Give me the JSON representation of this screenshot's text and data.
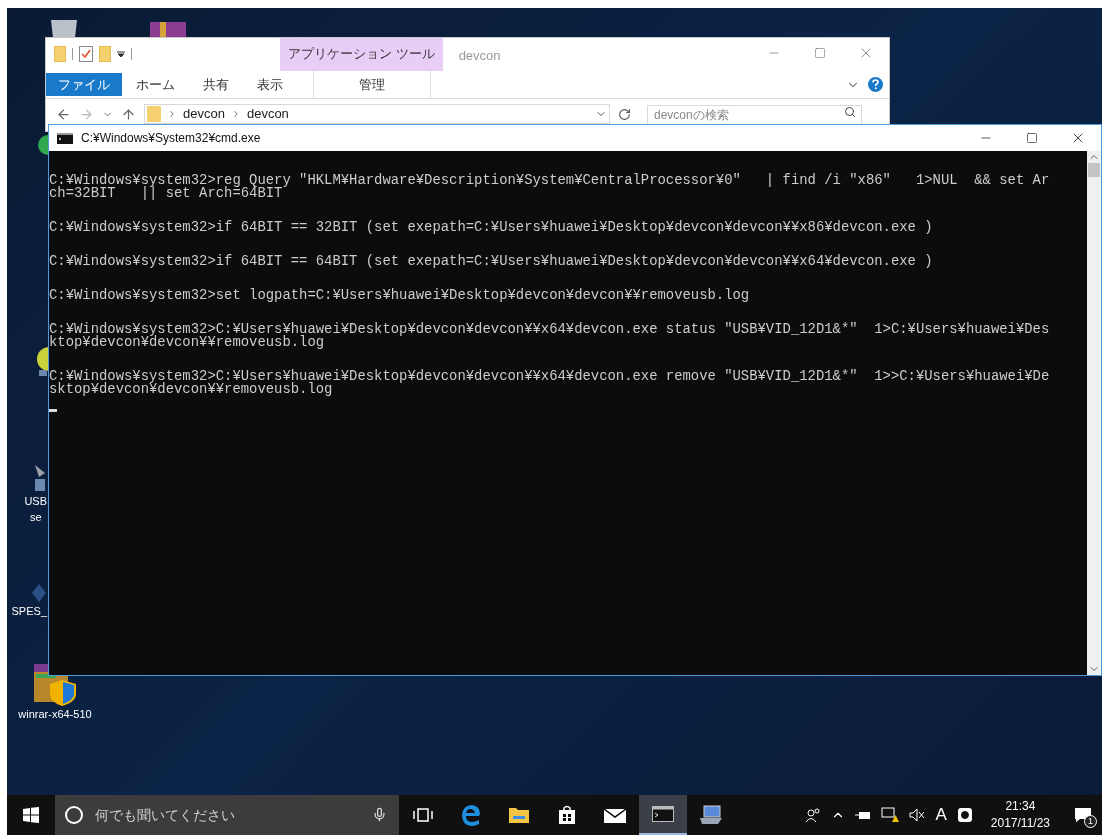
{
  "desktop": {
    "icons": [
      {
        "kind": "setup",
        "lines": [
          "USB",
          "se"
        ]
      },
      {
        "kind": "generic",
        "lines": [
          "SPES_"
        ]
      },
      {
        "kind": "winrar",
        "lines": [
          "winrar-x64-510"
        ]
      }
    ]
  },
  "explorer": {
    "context_group": "アプリケーション ツール",
    "title": "devcon",
    "tabs": [
      {
        "label": "ファイル",
        "kind": "file"
      },
      {
        "label": "ホーム",
        "kind": "tab"
      },
      {
        "label": "共有",
        "kind": "tab"
      },
      {
        "label": "表示",
        "kind": "tab"
      },
      {
        "label": "管理",
        "kind": "context"
      }
    ],
    "breadcrumb": [
      "devcon",
      "devcon"
    ],
    "search": {
      "placeholder": "devconの検索"
    }
  },
  "cmd": {
    "title": "C:¥Windows¥System32¥cmd.exe",
    "blocks": [
      {
        "lines": [
          "C:¥Windows¥system32>reg Query \"HKLM¥Hardware¥Description¥System¥CentralProcessor¥0\"   | find /i \"x86\"   1>NUL  && set Ar",
          "ch=32BIT   || set Arch=64BIT"
        ]
      },
      {
        "lines": [
          "C:¥Windows¥system32>if 64BIT == 32BIT (set exepath=C:¥Users¥huawei¥Desktop¥devcon¥devcon¥¥x86¥devcon.exe )"
        ]
      },
      {
        "lines": [
          "C:¥Windows¥system32>if 64BIT == 64BIT (set exepath=C:¥Users¥huawei¥Desktop¥devcon¥devcon¥¥x64¥devcon.exe )"
        ]
      },
      {
        "lines": [
          "C:¥Windows¥system32>set logpath=C:¥Users¥huawei¥Desktop¥devcon¥devcon¥¥removeusb.log"
        ]
      },
      {
        "lines": [
          "C:¥Windows¥system32>C:¥Users¥huawei¥Desktop¥devcon¥devcon¥¥x64¥devcon.exe status \"USB¥VID_12D1&*\"  1>C:¥Users¥huawei¥Des",
          "ktop¥devcon¥devcon¥¥removeusb.log"
        ]
      },
      {
        "lines": [
          "C:¥Windows¥system32>C:¥Users¥huawei¥Desktop¥devcon¥devcon¥¥x64¥devcon.exe remove \"USB¥VID_12D1&*\"  1>>C:¥Users¥huawei¥De",
          "sktop¥devcon¥devcon¥¥removeusb.log"
        ]
      }
    ]
  },
  "taskbar": {
    "search": {
      "placeholder": "何でも聞いてください"
    },
    "apps": [
      {
        "kind": "taskview",
        "active": false
      },
      {
        "kind": "edge",
        "active": false
      },
      {
        "kind": "explorer",
        "active": false
      },
      {
        "kind": "store",
        "active": false
      },
      {
        "kind": "mail",
        "active": false
      },
      {
        "kind": "cmd",
        "active": true
      },
      {
        "kind": "device",
        "active": false
      }
    ],
    "input_indicator": "A",
    "time": "21:34",
    "date": "2017/11/23",
    "notification_count": "1"
  }
}
